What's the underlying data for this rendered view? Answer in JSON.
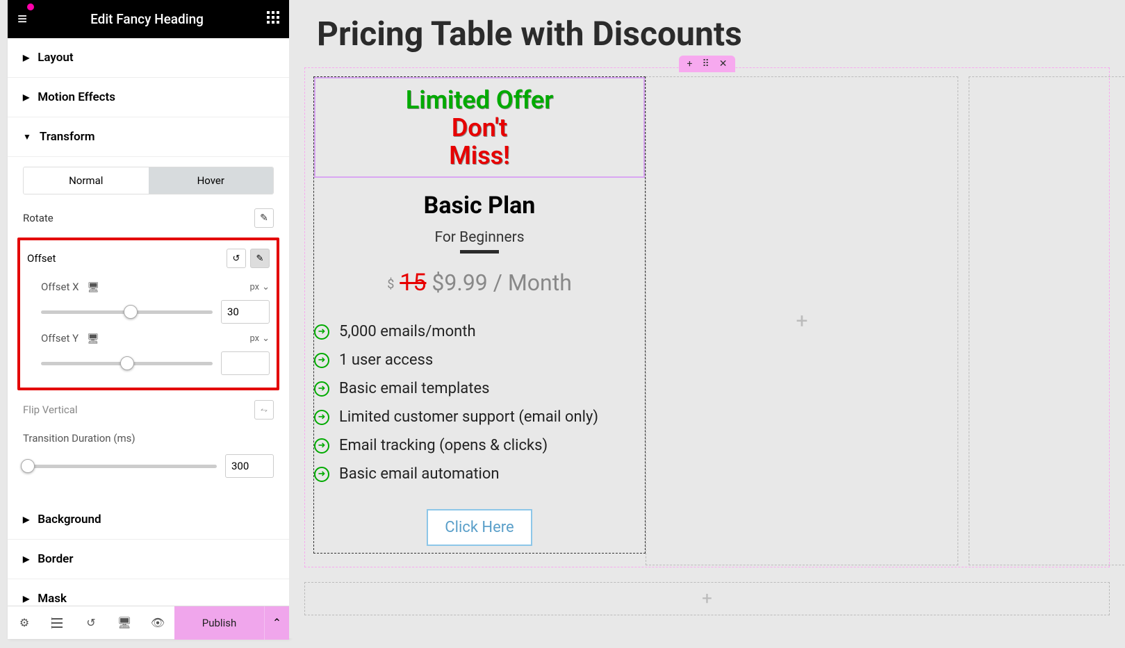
{
  "sidebar": {
    "title": "Edit Fancy Heading",
    "sections": {
      "layout": "Layout",
      "motion": "Motion Effects",
      "transform": "Transform",
      "background": "Background",
      "border": "Border",
      "mask": "Mask"
    },
    "state_tabs": {
      "normal": "Normal",
      "hover": "Hover"
    },
    "rotate_label": "Rotate",
    "offset": {
      "label": "Offset",
      "x_label": "Offset X",
      "y_label": "Offset Y",
      "unit": "px",
      "x_value": "30",
      "y_value": ""
    },
    "flip_vertical": "Flip Vertical",
    "transition": {
      "label": "Transition Duration (ms)",
      "value": "300"
    }
  },
  "bottom": {
    "publish": "Publish"
  },
  "canvas": {
    "page_title": "Pricing Table with Discounts",
    "offer": {
      "title": "Limited Offer",
      "line1": "Don't",
      "line2": "Miss!"
    },
    "plan": {
      "name": "Basic Plan",
      "sub": "For Beginners",
      "currency": "$",
      "strike": "15",
      "price": "$9.99 / Month",
      "features": [
        "5,000 emails/month",
        "1 user access",
        "Basic email templates",
        "Limited customer support (email only)",
        "Email tracking (opens & clicks)",
        "Basic email automation"
      ],
      "cta": "Click Here"
    },
    "section_handle": {
      "add": "+",
      "drag": "⠿",
      "close": "✕"
    }
  }
}
